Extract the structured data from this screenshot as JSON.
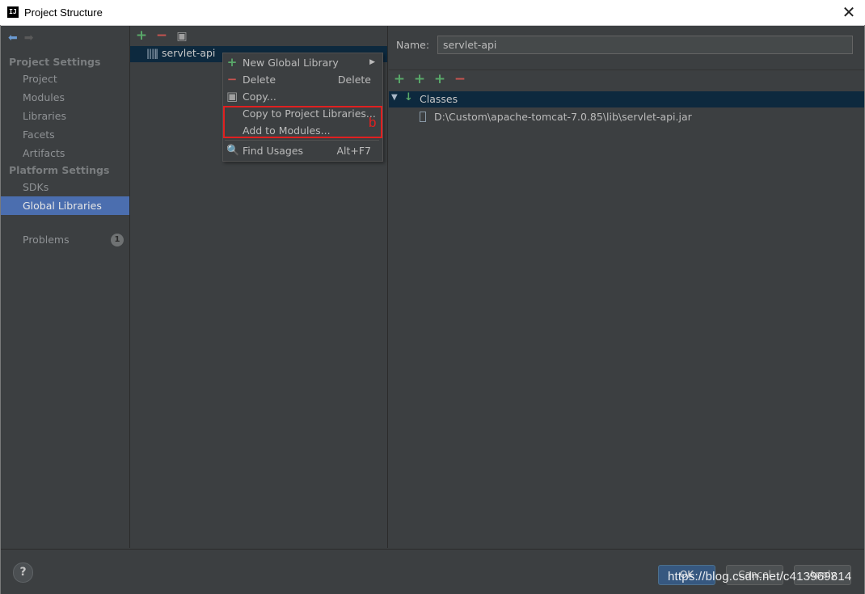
{
  "window": {
    "title": "Project Structure",
    "close": "✕"
  },
  "left": {
    "project_settings": "Project Settings",
    "project_items": [
      "Project",
      "Modules",
      "Libraries",
      "Facets",
      "Artifacts"
    ],
    "platform_settings": "Platform Settings",
    "platform_items": [
      "SDKs",
      "Global Libraries"
    ],
    "problems": "Problems",
    "problems_count": "1"
  },
  "middle": {
    "library": "servlet-api"
  },
  "right": {
    "name_label": "Name:",
    "name_value": "servlet-api",
    "tree_root": "Classes",
    "tree_child": "D:\\Custom\\apache-tomcat-7.0.85\\lib\\servlet-api.jar"
  },
  "context_menu": {
    "items": [
      {
        "label": "New Global Library",
        "shortcut": ""
      },
      {
        "label": "Delete",
        "shortcut": "Delete"
      },
      {
        "label": "Copy...",
        "shortcut": ""
      },
      {
        "label": "Copy to Project Libraries...",
        "shortcut": ""
      },
      {
        "label": "Add to Modules...",
        "shortcut": ""
      },
      {
        "label": "Find Usages",
        "shortcut": "Alt+F7"
      }
    ],
    "annotation": "b"
  },
  "buttons": {
    "ok": "OK",
    "cancel": "Cancel",
    "apply": "Apply",
    "help": "?"
  },
  "watermark": "https://blog.csdn.net/c413969814",
  "colors": {
    "selection": "#4b6eaf",
    "annotation": "#e02020",
    "plus": "#59a869",
    "minus": "#c75450"
  }
}
